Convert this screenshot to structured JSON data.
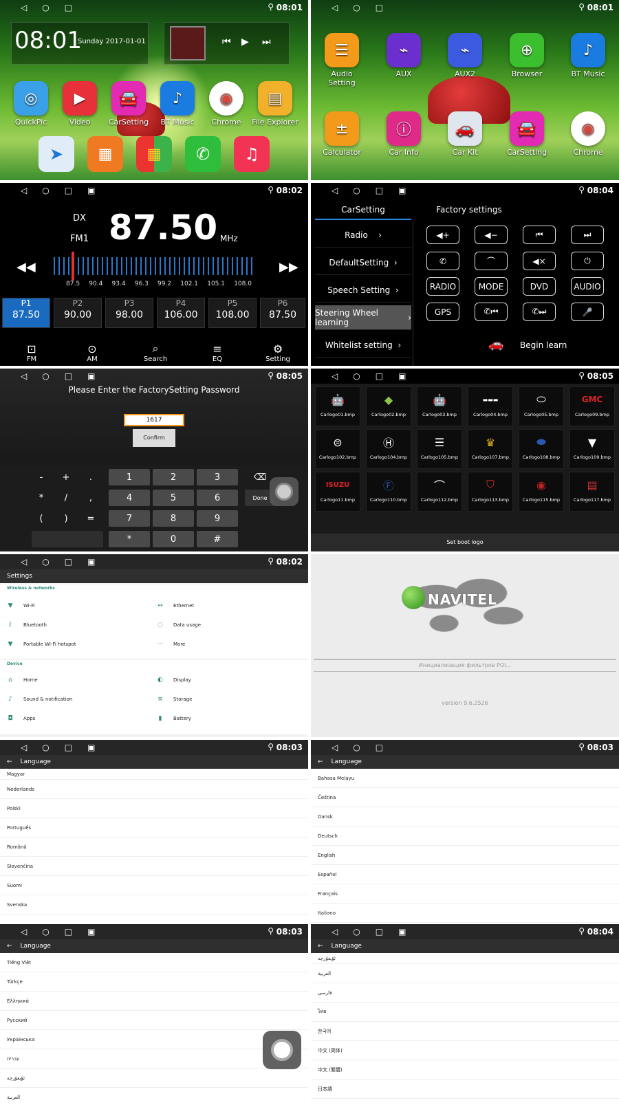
{
  "status": {
    "times": [
      "08:01",
      "08:01",
      "08:02",
      "08:04",
      "08:05",
      "08:05",
      "08:02",
      "08:03",
      "08:03",
      "08:03",
      "08:04"
    ]
  },
  "home1": {
    "clock": "08:01",
    "date": "Sunday 2017-01-01",
    "apps": [
      "QuickPic",
      "Video",
      "CarSetting",
      "BT Music",
      "Chrome",
      "File Explorer"
    ]
  },
  "home2": {
    "apps_row1": [
      "Audio Setting",
      "AUX",
      "AUX2",
      "Browser",
      "BT Music"
    ],
    "apps_row2": [
      "Calculator",
      "Car Info",
      "Car Kit",
      "CarSetting",
      "Chrome"
    ]
  },
  "radio": {
    "dx": "DX",
    "band": "FM1",
    "freq": "87.50",
    "unit": "MHz",
    "scale": [
      "87.5",
      "90.4",
      "93.4",
      "96.3",
      "99.2",
      "102.1",
      "105.1",
      "108.0"
    ],
    "presets": [
      {
        "name": "P1",
        "value": "87.50"
      },
      {
        "name": "P2",
        "value": "90.00"
      },
      {
        "name": "P3",
        "value": "98.00"
      },
      {
        "name": "P4",
        "value": "106.00"
      },
      {
        "name": "P5",
        "value": "108.00"
      },
      {
        "name": "P6",
        "value": "87.50"
      }
    ],
    "nav": [
      "FM",
      "AM",
      "Search",
      "EQ",
      "Setting"
    ]
  },
  "carsetting": {
    "tab_active": "CarSetting",
    "tab_other": "Factory settings",
    "menu": [
      "Radio",
      "DefaultSetting",
      "Speech Setting",
      "Steering Wheel learning",
      "Whitelist setting"
    ],
    "buttons_text": [
      "RADIO",
      "MODE",
      "DVD",
      "AUDIO",
      "GPS"
    ],
    "begin": "Begin learn"
  },
  "factory": {
    "title": "Please Enter the FactorySetting Password",
    "password": "1617",
    "confirm": "Confirm",
    "done": "Done",
    "keys_left": [
      "-",
      "+",
      ".",
      "*",
      "/",
      ",",
      "(",
      ")",
      "="
    ],
    "keys_num": [
      "1",
      "2",
      "3",
      "4",
      "5",
      "6",
      "7",
      "8",
      "9",
      "*",
      "0",
      "#"
    ]
  },
  "bootlogo": {
    "files": [
      "Carlogo01.bmp",
      "Carlogo02.bmp",
      "Carlogo03.bmp",
      "Carlogo04.bmp",
      "Carlogo05.bmp",
      "Carlogo09.bmp",
      "Carlogo102.bmp",
      "Carlogo104.bmp",
      "Carlogo105.bmp",
      "Carlogo107.bmp",
      "Carlogo108.bmp",
      "Carlogo109.bmp",
      "Carlogo11.bmp",
      "Carlogo110.bmp",
      "Carlogo112.bmp",
      "Carlogo113.bmp",
      "Carlogo115.bmp",
      "Carlogo117.bmp"
    ],
    "brand_text": [
      "GMC",
      "ISUZU"
    ],
    "footer": "Set boot logo"
  },
  "settings": {
    "title": "Settings",
    "section1": "Wireless & networks",
    "wireless": [
      "Wi-Fi",
      "Ethernet",
      "Bluetooth",
      "Data usage",
      "Portable Wi-Fi hotspot",
      "More"
    ],
    "section2": "Device",
    "device": [
      "Home",
      "Display",
      "Sound & notification",
      "Storage",
      "Apps",
      "Battery"
    ]
  },
  "navitel": {
    "brand": "NAVITEL",
    "status": "Инициализация фильтров POI...",
    "version": "version 9.6.2526"
  },
  "lang_title": "Language",
  "lang1": [
    "Magyar",
    "Nederlands",
    "Polski",
    "Português",
    "Română",
    "Slovenčina",
    "Suomi",
    "Svenska"
  ],
  "lang2": [
    "Bahasa Melayu",
    "Čeština",
    "Dansk",
    "Deutsch",
    "English",
    "Español",
    "Français",
    "Italiano"
  ],
  "lang3": [
    "Tiếng Việt",
    "Türkçe",
    "Ελληνικά",
    "Русский",
    "Українська",
    "עברית",
    "ئۇيغۇرچە",
    "العربية"
  ],
  "lang4": [
    "ئۇيغۇرچە",
    "العربية",
    "فارسی",
    "ไทย",
    "한국어",
    "中文 (简体)",
    "中文 (繁體)",
    "日本語"
  ]
}
